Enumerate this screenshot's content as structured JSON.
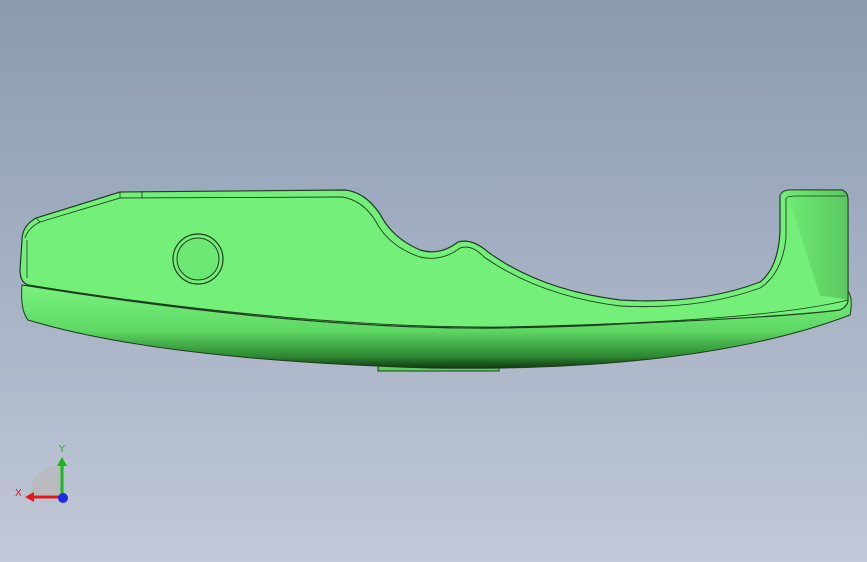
{
  "viewport": {
    "background_top": "#8a9bb0",
    "background_bottom": "#c2c9d8"
  },
  "model": {
    "face_color": "#74f07a",
    "edge_color": "#1f3d1f"
  },
  "triad": {
    "x_label": "X",
    "y_label": "Y",
    "x_color": "#e01a1a",
    "y_color": "#1ab81a",
    "z_color": "#1a2be0"
  }
}
